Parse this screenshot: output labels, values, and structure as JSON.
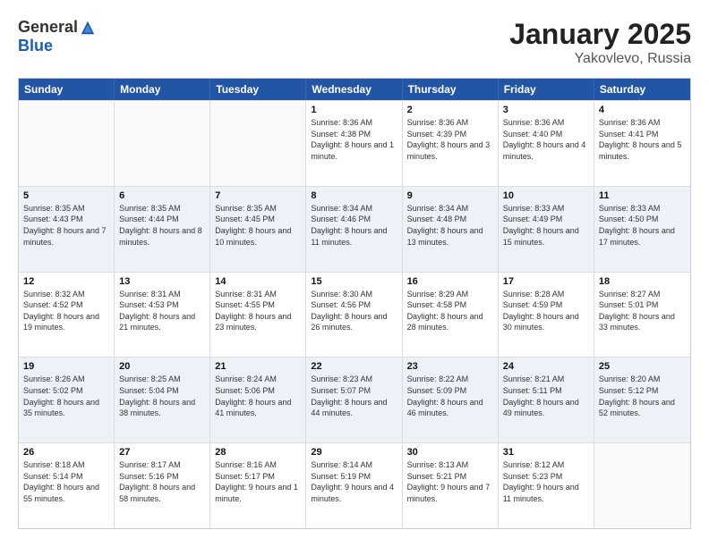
{
  "logo": {
    "general": "General",
    "blue": "Blue"
  },
  "title": "January 2025",
  "subtitle": "Yakovlevo, Russia",
  "header_days": [
    "Sunday",
    "Monday",
    "Tuesday",
    "Wednesday",
    "Thursday",
    "Friday",
    "Saturday"
  ],
  "rows": [
    [
      {
        "day": "",
        "sunrise": "",
        "sunset": "",
        "daylight": "",
        "empty": true
      },
      {
        "day": "",
        "sunrise": "",
        "sunset": "",
        "daylight": "",
        "empty": true
      },
      {
        "day": "",
        "sunrise": "",
        "sunset": "",
        "daylight": "",
        "empty": true
      },
      {
        "day": "1",
        "sunrise": "Sunrise: 8:36 AM",
        "sunset": "Sunset: 4:38 PM",
        "daylight": "Daylight: 8 hours and 1 minute."
      },
      {
        "day": "2",
        "sunrise": "Sunrise: 8:36 AM",
        "sunset": "Sunset: 4:39 PM",
        "daylight": "Daylight: 8 hours and 3 minutes."
      },
      {
        "day": "3",
        "sunrise": "Sunrise: 8:36 AM",
        "sunset": "Sunset: 4:40 PM",
        "daylight": "Daylight: 8 hours and 4 minutes."
      },
      {
        "day": "4",
        "sunrise": "Sunrise: 8:36 AM",
        "sunset": "Sunset: 4:41 PM",
        "daylight": "Daylight: 8 hours and 5 minutes."
      }
    ],
    [
      {
        "day": "5",
        "sunrise": "Sunrise: 8:35 AM",
        "sunset": "Sunset: 4:43 PM",
        "daylight": "Daylight: 8 hours and 7 minutes."
      },
      {
        "day": "6",
        "sunrise": "Sunrise: 8:35 AM",
        "sunset": "Sunset: 4:44 PM",
        "daylight": "Daylight: 8 hours and 8 minutes."
      },
      {
        "day": "7",
        "sunrise": "Sunrise: 8:35 AM",
        "sunset": "Sunset: 4:45 PM",
        "daylight": "Daylight: 8 hours and 10 minutes."
      },
      {
        "day": "8",
        "sunrise": "Sunrise: 8:34 AM",
        "sunset": "Sunset: 4:46 PM",
        "daylight": "Daylight: 8 hours and 11 minutes."
      },
      {
        "day": "9",
        "sunrise": "Sunrise: 8:34 AM",
        "sunset": "Sunset: 4:48 PM",
        "daylight": "Daylight: 8 hours and 13 minutes."
      },
      {
        "day": "10",
        "sunrise": "Sunrise: 8:33 AM",
        "sunset": "Sunset: 4:49 PM",
        "daylight": "Daylight: 8 hours and 15 minutes."
      },
      {
        "day": "11",
        "sunrise": "Sunrise: 8:33 AM",
        "sunset": "Sunset: 4:50 PM",
        "daylight": "Daylight: 8 hours and 17 minutes."
      }
    ],
    [
      {
        "day": "12",
        "sunrise": "Sunrise: 8:32 AM",
        "sunset": "Sunset: 4:52 PM",
        "daylight": "Daylight: 8 hours and 19 minutes."
      },
      {
        "day": "13",
        "sunrise": "Sunrise: 8:31 AM",
        "sunset": "Sunset: 4:53 PM",
        "daylight": "Daylight: 8 hours and 21 minutes."
      },
      {
        "day": "14",
        "sunrise": "Sunrise: 8:31 AM",
        "sunset": "Sunset: 4:55 PM",
        "daylight": "Daylight: 8 hours and 23 minutes."
      },
      {
        "day": "15",
        "sunrise": "Sunrise: 8:30 AM",
        "sunset": "Sunset: 4:56 PM",
        "daylight": "Daylight: 8 hours and 26 minutes."
      },
      {
        "day": "16",
        "sunrise": "Sunrise: 8:29 AM",
        "sunset": "Sunset: 4:58 PM",
        "daylight": "Daylight: 8 hours and 28 minutes."
      },
      {
        "day": "17",
        "sunrise": "Sunrise: 8:28 AM",
        "sunset": "Sunset: 4:59 PM",
        "daylight": "Daylight: 8 hours and 30 minutes."
      },
      {
        "day": "18",
        "sunrise": "Sunrise: 8:27 AM",
        "sunset": "Sunset: 5:01 PM",
        "daylight": "Daylight: 8 hours and 33 minutes."
      }
    ],
    [
      {
        "day": "19",
        "sunrise": "Sunrise: 8:26 AM",
        "sunset": "Sunset: 5:02 PM",
        "daylight": "Daylight: 8 hours and 35 minutes."
      },
      {
        "day": "20",
        "sunrise": "Sunrise: 8:25 AM",
        "sunset": "Sunset: 5:04 PM",
        "daylight": "Daylight: 8 hours and 38 minutes."
      },
      {
        "day": "21",
        "sunrise": "Sunrise: 8:24 AM",
        "sunset": "Sunset: 5:06 PM",
        "daylight": "Daylight: 8 hours and 41 minutes."
      },
      {
        "day": "22",
        "sunrise": "Sunrise: 8:23 AM",
        "sunset": "Sunset: 5:07 PM",
        "daylight": "Daylight: 8 hours and 44 minutes."
      },
      {
        "day": "23",
        "sunrise": "Sunrise: 8:22 AM",
        "sunset": "Sunset: 5:09 PM",
        "daylight": "Daylight: 8 hours and 46 minutes."
      },
      {
        "day": "24",
        "sunrise": "Sunrise: 8:21 AM",
        "sunset": "Sunset: 5:11 PM",
        "daylight": "Daylight: 8 hours and 49 minutes."
      },
      {
        "day": "25",
        "sunrise": "Sunrise: 8:20 AM",
        "sunset": "Sunset: 5:12 PM",
        "daylight": "Daylight: 8 hours and 52 minutes."
      }
    ],
    [
      {
        "day": "26",
        "sunrise": "Sunrise: 8:18 AM",
        "sunset": "Sunset: 5:14 PM",
        "daylight": "Daylight: 8 hours and 55 minutes."
      },
      {
        "day": "27",
        "sunrise": "Sunrise: 8:17 AM",
        "sunset": "Sunset: 5:16 PM",
        "daylight": "Daylight: 8 hours and 58 minutes."
      },
      {
        "day": "28",
        "sunrise": "Sunrise: 8:16 AM",
        "sunset": "Sunset: 5:17 PM",
        "daylight": "Daylight: 9 hours and 1 minute."
      },
      {
        "day": "29",
        "sunrise": "Sunrise: 8:14 AM",
        "sunset": "Sunset: 5:19 PM",
        "daylight": "Daylight: 9 hours and 4 minutes."
      },
      {
        "day": "30",
        "sunrise": "Sunrise: 8:13 AM",
        "sunset": "Sunset: 5:21 PM",
        "daylight": "Daylight: 9 hours and 7 minutes."
      },
      {
        "day": "31",
        "sunrise": "Sunrise: 8:12 AM",
        "sunset": "Sunset: 5:23 PM",
        "daylight": "Daylight: 9 hours and 11 minutes."
      },
      {
        "day": "",
        "sunrise": "",
        "sunset": "",
        "daylight": "",
        "empty": true
      }
    ]
  ]
}
